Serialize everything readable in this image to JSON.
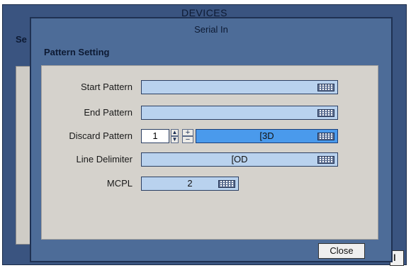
{
  "background_window": {
    "title": "DEVICES",
    "side_label": "Se",
    "button_fragment": "l"
  },
  "dialog": {
    "title": "Serial In",
    "group_label": "Pattern Setting",
    "fields": {
      "start_pattern": {
        "label": "Start Pattern",
        "value": ""
      },
      "end_pattern": {
        "label": "End Pattern",
        "value": ""
      },
      "discard_pattern": {
        "label": "Discard Pattern",
        "count": "1",
        "value": "[3D",
        "selected": true
      },
      "line_delimiter": {
        "label": "Line Delimiter",
        "value": "[OD"
      },
      "mcpl": {
        "label": "MCPL",
        "value": "2"
      }
    },
    "spin_up_glyph": "▲",
    "spin_down_glyph": "▼",
    "plus_glyph": "+",
    "minus_glyph": "−",
    "close_label": "Close"
  },
  "icons": {
    "keyboard": "keyboard-icon"
  },
  "colors": {
    "window_bg": "#3a5480",
    "dialog_bg": "#4d6c98",
    "panel_bg": "#d5d2cc",
    "field_bg": "#b9d2ee",
    "field_selected_bg": "#4a9aec"
  }
}
